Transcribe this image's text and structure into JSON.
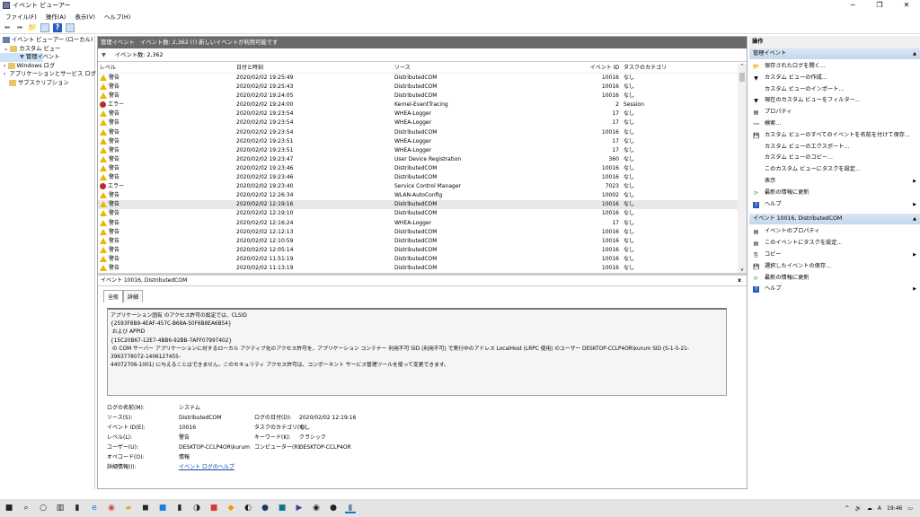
{
  "window": {
    "title": "イベント ビューアー",
    "controls": [
      "─",
      "❐",
      "✕"
    ]
  },
  "menu": [
    "ファイル(F)",
    "操作(A)",
    "表示(V)",
    "ヘルプ(H)"
  ],
  "tree": {
    "root": "イベント ビューアー (ローカル)",
    "custom_views": "カスタム ビュー",
    "admin_events": "管理イベント",
    "windows_logs": "Windows ログ",
    "app_service_logs": "アプリケーションとサービス ログ",
    "subscriptions": "サブスクリプション"
  },
  "center": {
    "header": "管理イベント　イベント数: 2,362 (!) 新しいイベントが利用可能です",
    "filter_label": "イベント数: 2,362",
    "columns": [
      "レベル",
      "日付と時刻",
      "ソース",
      "イベント ID",
      "タスクのカテゴリ"
    ],
    "rows": [
      [
        "警告",
        "2020/02/02 19:25:49",
        "DistributedCOM",
        "10016",
        "なし"
      ],
      [
        "警告",
        "2020/02/02 19:25:43",
        "DistributedCOM",
        "10016",
        "なし"
      ],
      [
        "警告",
        "2020/02/02 19:24:05",
        "DistributedCOM",
        "10016",
        "なし"
      ],
      [
        "エラー",
        "2020/02/02 19:24:00",
        "Kernel-EventTracing",
        "2",
        "Session"
      ],
      [
        "警告",
        "2020/02/02 19:23:54",
        "WHEA-Logger",
        "17",
        "なし"
      ],
      [
        "警告",
        "2020/02/02 19:23:54",
        "WHEA-Logger",
        "17",
        "なし"
      ],
      [
        "警告",
        "2020/02/02 19:23:54",
        "DistributedCOM",
        "10016",
        "なし"
      ],
      [
        "警告",
        "2020/02/02 19:23:51",
        "WHEA-Logger",
        "17",
        "なし"
      ],
      [
        "警告",
        "2020/02/02 19:23:51",
        "WHEA-Logger",
        "17",
        "なし"
      ],
      [
        "警告",
        "2020/02/02 19:23:47",
        "User Device Registration",
        "360",
        "なし"
      ],
      [
        "警告",
        "2020/02/02 19:23:46",
        "DistributedCOM",
        "10016",
        "なし"
      ],
      [
        "警告",
        "2020/02/02 19:23:46",
        "DistributedCOM",
        "10016",
        "なし"
      ],
      [
        "エラー",
        "2020/02/02 19:23:40",
        "Service Control Manager",
        "7023",
        "なし"
      ],
      [
        "警告",
        "2020/02/02 12:26:34",
        "WLAN-AutoConfig",
        "10002",
        "なし"
      ],
      [
        "警告",
        "2020/02/02 12:19:16",
        "DistributedCOM",
        "10016",
        "なし"
      ],
      [
        "警告",
        "2020/02/02 12:19:10",
        "DistributedCOM",
        "10016",
        "なし"
      ],
      [
        "警告",
        "2020/02/02 12:16:24",
        "WHEA-Logger",
        "17",
        "なし"
      ],
      [
        "警告",
        "2020/02/02 12:12:13",
        "DistributedCOM",
        "10016",
        "なし"
      ],
      [
        "警告",
        "2020/02/02 12:10:59",
        "DistributedCOM",
        "10016",
        "なし"
      ],
      [
        "警告",
        "2020/02/02 12:05:14",
        "DistributedCOM",
        "10016",
        "なし"
      ],
      [
        "警告",
        "2020/02/02 11:51:19",
        "DistributedCOM",
        "10016",
        "なし"
      ],
      [
        "警告",
        "2020/02/02 11:13:19",
        "DistributedCOM",
        "10016",
        "なし"
      ]
    ],
    "selected_row": 14
  },
  "detail": {
    "header": "イベント 10016, DistributedCOM",
    "close": "x",
    "tabs": [
      "全般",
      "詳細"
    ],
    "description": "アプリケーション固有 のアクセス許可の設定では、CLSID\n{2593F8B9-4EAF-457C-B68A-50F6B8EA6B54}\n および APPID\n{15C20B67-12E7-4BB6-92BB-7AFF07997402}\n の COM サーバー アプリケーションに対するローカル アクティブ化のアクセス許可を、アプリケーション コンテナー 利用不可 SID (利用不可) で実行中のアドレス LocalHost (LRPC 使用) のユーザー DESKTOP-CCLP4OR\\kurum SID (S-1-5-21-3963778072-1406127455-\n44072706-1001) に与えることはできません。このセキュリティ アクセス許可は、コンポーネント サービス管理ツールを使って変更できます。",
    "props": {
      "log_name_label": "ログの名前(M):",
      "log_name": "システム",
      "source_label": "ソース(S):",
      "source": "DistributedCOM",
      "logged_label": "ログの日付(D):",
      "logged": "2020/02/02 12:19:16",
      "event_id_label": "イベント ID(E):",
      "event_id": "10016",
      "task_label": "タスクのカテゴリ(Y):",
      "task": "なし",
      "level_label": "レベル(L):",
      "level": "警告",
      "keywords_label": "キーワード(K):",
      "keywords": "クラシック",
      "user_label": "ユーザー(U):",
      "user": "DESKTOP-CCLP4OR\\kurum",
      "computer_label": "コンピューター(R):",
      "computer": "DESKTOP-CCLP4OR",
      "opcode_label": "オペコード(O):",
      "opcode": "情報",
      "more_label": "詳細情報(I):",
      "more_link": "イベント ログのヘルプ"
    }
  },
  "actions": {
    "title": "操作",
    "section1": "管理イベント",
    "items1": [
      {
        "label": "保存されたログを開く...",
        "icon": "📂"
      },
      {
        "label": "カスタム ビューの作成...",
        "icon": "▼"
      },
      {
        "label": "カスタム ビューのインポート...",
        "icon": ""
      },
      {
        "label": "現在のカスタム ビューをフィルター...",
        "icon": "▼"
      },
      {
        "label": "プロパティ",
        "icon": "▤"
      },
      {
        "label": "検索...",
        "icon": "👓"
      },
      {
        "label": "カスタム ビューのすべてのイベントを名前を付けて保存...",
        "icon": "💾"
      },
      {
        "label": "カスタム ビューのエクスポート...",
        "icon": ""
      },
      {
        "label": "カスタム ビューのコピー...",
        "icon": ""
      },
      {
        "label": "このカスタム ビューにタスクを設定...",
        "icon": ""
      },
      {
        "label": "表示",
        "icon": "",
        "sub": true
      },
      {
        "label": "最新の情報に更新",
        "icon": "⟳"
      },
      {
        "label": "ヘルプ",
        "icon": "?",
        "sub": true
      }
    ],
    "section2": "イベント 10016, DistributedCOM",
    "items2": [
      {
        "label": "イベントのプロパティ",
        "icon": "▤"
      },
      {
        "label": "このイベントにタスクを設定...",
        "icon": "▤"
      },
      {
        "label": "コピー",
        "icon": "⎘",
        "sub": true
      },
      {
        "label": "選択したイベントの保存...",
        "icon": "💾"
      },
      {
        "label": "最新の情報に更新",
        "icon": "⟳"
      },
      {
        "label": "ヘルプ",
        "icon": "?",
        "sub": true
      }
    ]
  },
  "taskbar": {
    "clock": "19:46",
    "ime": "A"
  }
}
